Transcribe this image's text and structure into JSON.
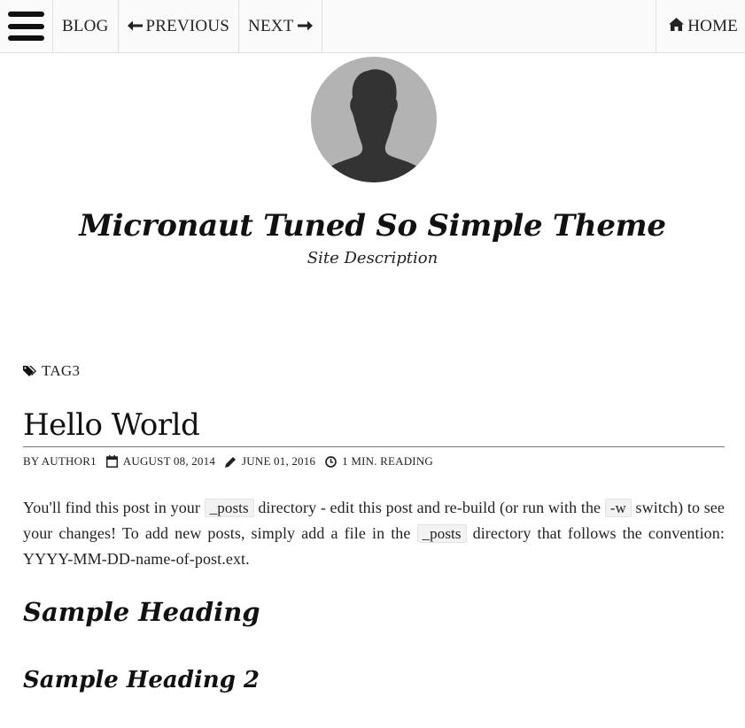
{
  "nav": {
    "blog_label": "BLOG",
    "previous_label": "PREVIOUS",
    "next_label": "NEXT",
    "home_label": "HOME",
    "icons": {
      "menu": "hamburger-menu-icon",
      "previous": "arrow-left-icon",
      "next": "arrow-right-icon",
      "home": "home-icon"
    }
  },
  "header": {
    "avatar": "avatar-silhouette",
    "site_title": "Micronaut Tuned So Simple Theme",
    "site_description": "Site Description"
  },
  "post": {
    "tag": "TAG3",
    "title": "Hello World",
    "meta": {
      "author": "BY AUTHOR1",
      "published": "AUGUST 08, 2014",
      "modified": "JUNE 01, 2016",
      "reading_time": "1 MIN. READING"
    },
    "paragraph": {
      "part1": "You'll find this post in your ",
      "code1": "_posts",
      "part2": " directory - edit this post and re-build (or run with the ",
      "code2": "-w",
      "part3": " switch) to see your changes! To add new posts, simply add a file in the ",
      "code3": "_posts",
      "part4": " directory that follows the convention: YYYY-MM-DD-name-of-post.ext."
    },
    "heading1": "Sample Heading",
    "heading2": "Sample Heading 2"
  },
  "colors": {
    "navbar_bg": "#fafafa",
    "border": "#dedede",
    "avatar_bg": "#b3b3b3",
    "avatar_fg": "#333333",
    "text": "#222222"
  }
}
